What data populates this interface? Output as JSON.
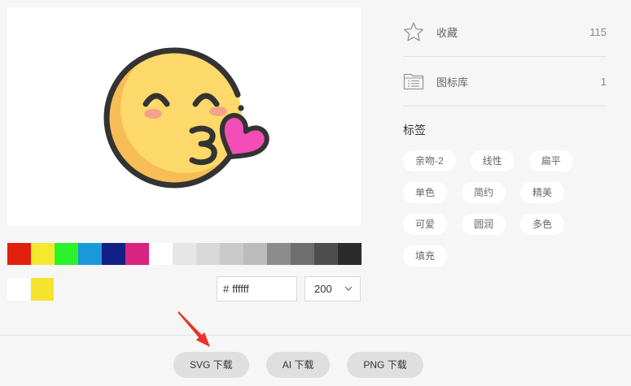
{
  "preview": {
    "icon": "kissing-face-heart-icon"
  },
  "palette": {
    "colors": [
      "#e0200d",
      "#f5e92e",
      "#2ef12c",
      "#1a98da",
      "#132083",
      "#d8237f",
      "#ffffff",
      "#e6e6e6",
      "#d9d9d9",
      "#cacaca",
      "#bbbbbb",
      "#8c8c8c",
      "#6e6e6e",
      "#4e4e4e",
      "#2b2b2b"
    ]
  },
  "current_colors": [
    "#ffffff",
    "#f5e42e"
  ],
  "color_input": {
    "prefix": "#",
    "value": "ffffff"
  },
  "size_select": {
    "value": "200",
    "icon": "chevron-down-icon"
  },
  "downloads": {
    "svg": "SVG 下载",
    "ai": "AI 下载",
    "png": "PNG 下载"
  },
  "stats": [
    {
      "icon": "star-icon",
      "label": "收藏",
      "count": "115"
    },
    {
      "icon": "icon-library-icon",
      "label": "图标库",
      "count": "1"
    }
  ],
  "tags": {
    "title": "标签",
    "items": [
      "亲吻-2",
      "线性",
      "扁平",
      "单色",
      "简约",
      "精美",
      "可爱",
      "圆润",
      "多色",
      "填充"
    ]
  },
  "annotation": {
    "icon": "red-arrow-icon",
    "color": "#e8352b"
  }
}
